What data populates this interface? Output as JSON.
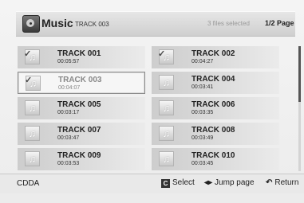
{
  "header": {
    "title": "Music",
    "current_track": "TRACK 003",
    "files_selected": "3 files selected",
    "page": "1/2 Page"
  },
  "tracks": [
    {
      "name": "TRACK 001",
      "time": "00:05:57",
      "checked": true
    },
    {
      "name": "TRACK 002",
      "time": "00:04:27",
      "checked": true
    },
    {
      "name": "TRACK 003",
      "time": "00:04:07",
      "checked": true
    },
    {
      "name": "TRACK 004",
      "time": "00:03:41",
      "checked": false
    },
    {
      "name": "TRACK 005",
      "time": "00:03:17",
      "checked": false
    },
    {
      "name": "TRACK 006",
      "time": "00:03:35",
      "checked": false
    },
    {
      "name": "TRACK 007",
      "time": "00:03:47",
      "checked": false
    },
    {
      "name": "TRACK 008",
      "time": "00:03:49",
      "checked": false
    },
    {
      "name": "TRACK 009",
      "time": "00:03:53",
      "checked": false
    },
    {
      "name": "TRACK 010",
      "time": "00:03:45",
      "checked": false
    }
  ],
  "footer": {
    "source": "CDDA",
    "select_key": "C",
    "select_label": "Select",
    "jump_icon": "◂▸",
    "jump_label": "Jump page",
    "return_icon": "↶",
    "return_label": "Return"
  }
}
